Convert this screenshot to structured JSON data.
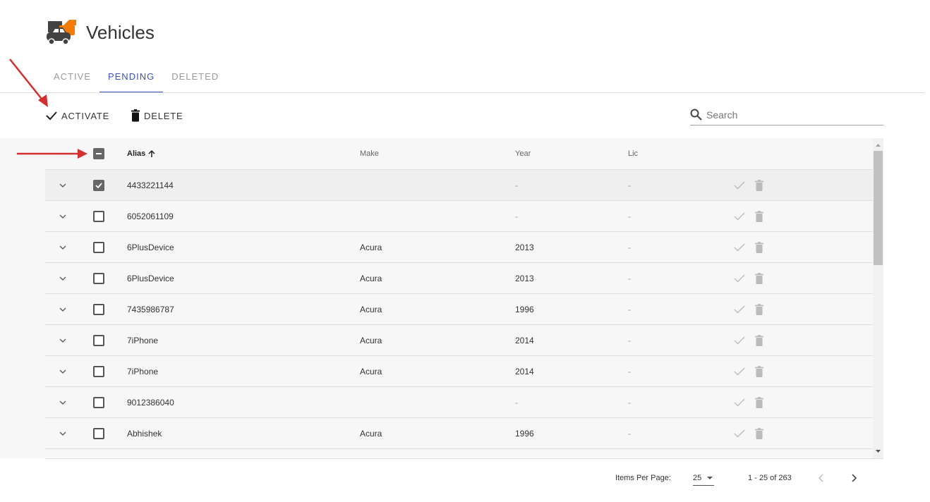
{
  "header": {
    "title": "Vehicles",
    "logo_icon": "vehicles-logo-icon"
  },
  "tabs": [
    {
      "label": "ACTIVE",
      "active": false
    },
    {
      "label": "PENDING",
      "active": true
    },
    {
      "label": "DELETED",
      "active": false
    }
  ],
  "toolbar": {
    "activate_label": "ACTIVATE",
    "delete_label": "DELETE"
  },
  "search": {
    "placeholder": "Search",
    "value": ""
  },
  "table": {
    "columns": {
      "alias": "Alias",
      "make": "Make",
      "year": "Year",
      "lic": "Lic"
    },
    "sort": {
      "column": "alias",
      "direction": "asc"
    },
    "header_checkbox": "indeterminate",
    "rows": [
      {
        "alias": "4433221144",
        "make": "",
        "year": "-",
        "lic": "-",
        "checked": true
      },
      {
        "alias": "6052061109",
        "make": "",
        "year": "-",
        "lic": "-",
        "checked": false
      },
      {
        "alias": "6PlusDevice",
        "make": "Acura",
        "year": "2013",
        "lic": "-",
        "checked": false
      },
      {
        "alias": "6PlusDevice",
        "make": "Acura",
        "year": "2013",
        "lic": "-",
        "checked": false
      },
      {
        "alias": "7435986787",
        "make": "Acura",
        "year": "1996",
        "lic": "-",
        "checked": false
      },
      {
        "alias": "7iPhone",
        "make": "Acura",
        "year": "2014",
        "lic": "-",
        "checked": false
      },
      {
        "alias": "7iPhone",
        "make": "Acura",
        "year": "2014",
        "lic": "-",
        "checked": false
      },
      {
        "alias": "9012386040",
        "make": "",
        "year": "-",
        "lic": "-",
        "checked": false
      },
      {
        "alias": "Abhishek",
        "make": "Acura",
        "year": "1996",
        "lic": "-",
        "checked": false
      }
    ]
  },
  "pagination": {
    "items_per_page_label": "Items Per Page:",
    "items_per_page": "25",
    "range": "1 - 25 of 263"
  },
  "colors": {
    "accent": "#3f51b5",
    "annotation_arrow": "#d32f2f",
    "logo_orange": "#f57c00"
  }
}
